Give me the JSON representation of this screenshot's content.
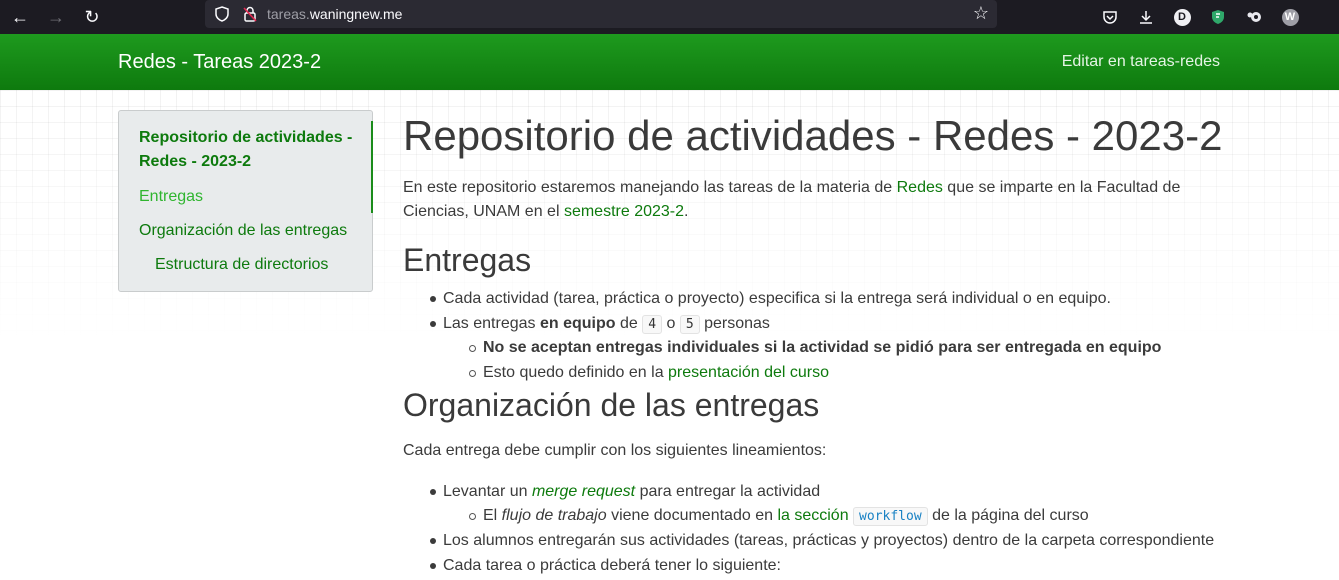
{
  "browser": {
    "url_prefix": "tareas.",
    "url_domain": "waningnew.me",
    "account_initial_1": "D",
    "account_initial_2": "W"
  },
  "header": {
    "site_title": "Redes - Tareas 2023-2",
    "edit_link": "Editar en tareas-redes"
  },
  "toc": {
    "main": "Repositorio de actividades - Redes - 2023-2",
    "entregas": "Entregas",
    "organizacion": "Organización de las entregas",
    "estructura": "Estructura de directorios"
  },
  "main": {
    "title": "Repositorio de actividades - Redes - 2023-2",
    "intro_1": "En este repositorio estaremos manejando las tareas de la materia de ",
    "intro_link_redes": "Redes",
    "intro_2": " que se imparte en la Facultad de",
    "intro_3": "Ciencias, UNAM en el ",
    "intro_link_semestre": "semestre 2023-2",
    "intro_4": ".",
    "entregas_heading": "Entregas",
    "entregas_items": {
      "item1": "Cada actividad (tarea, práctica o proyecto) especifica si la entrega será individual o en equipo.",
      "item2_a": "Las entregas ",
      "item2_b": "en equipo",
      "item2_c": " de ",
      "item2_n1": "4",
      "item2_d": " o ",
      "item2_n2": "5",
      "item2_e": " personas",
      "sub1": "No se aceptan entregas individuales si la actividad se pidió para ser entregada en equipo",
      "sub2_a": "Esto quedo definido en la ",
      "sub2_link": "presentación del curso"
    },
    "org_heading": "Organización de las entregas",
    "org_intro": "Cada entrega debe cumplir con los siguientes lineamientos:",
    "org_items": {
      "item1_a": "Levantar un ",
      "item1_link": "merge request",
      "item1_b": " para entregar la actividad",
      "sub1_a": "El ",
      "sub1_i": "flujo de trabajo",
      "sub1_b": " viene documentado en ",
      "sub1_link": "la sección",
      "sub1_code": "workflow",
      "sub1_c": " de la página del curso",
      "item2": "Los alumnos entregarán sus actividades (tareas, prácticas y proyectos) dentro de la carpeta correspondiente",
      "item3": "Cada tarea o práctica deberá tener lo siguiente:"
    }
  }
}
